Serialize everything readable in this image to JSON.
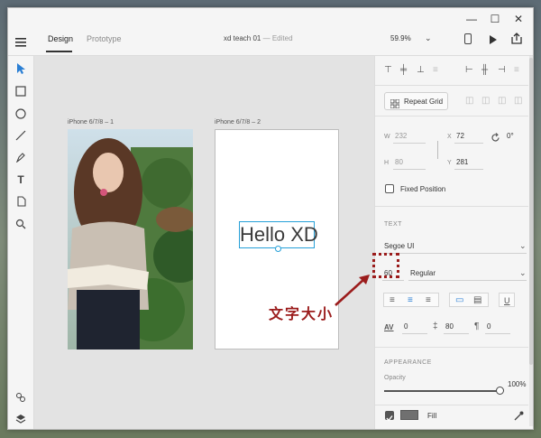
{
  "window": {
    "controls": [
      "—",
      "☐",
      "✕"
    ]
  },
  "toolbar": {
    "tabs": [
      {
        "label": "Design",
        "active": true
      },
      {
        "label": "Prototype",
        "active": false
      }
    ],
    "document_title": "xd teach 01",
    "document_separator": "—",
    "document_status": "Edited",
    "zoom": "59.9%"
  },
  "tools": [
    "select-tool",
    "rectangle-tool",
    "ellipse-tool",
    "line-tool",
    "pen-tool",
    "text-tool",
    "artboard-tool",
    "zoom-tool",
    "assets-tool",
    "layers-tool"
  ],
  "canvas": {
    "artboard1_label": "iPhone 6/7/8 – 1",
    "artboard2_label": "iPhone 6/7/8 – 2",
    "text_layer": "Hello XD"
  },
  "panel": {
    "repeat_grid_label": "Repeat Grid",
    "transform": {
      "w_label": "W",
      "w_value": "232",
      "h_label": "H",
      "h_value": "80",
      "x_label": "X",
      "x_value": "72",
      "y_label": "Y",
      "y_value": "281",
      "rotation": "0°"
    },
    "fixed_position_label": "Fixed Position",
    "text_section_label": "TEXT",
    "font_family": "Segoe UI",
    "font_size": "60",
    "font_weight": "Regular",
    "char_spacing": "0",
    "line_spacing": "80",
    "paragraph_spacing": "0",
    "appearance_label": "APPEARANCE",
    "opacity_label": "Opacity",
    "opacity_value": "100%",
    "opacity_level": 1.0,
    "fill_label": "Fill",
    "fill_color": "#707070"
  },
  "annotation": {
    "label": "文字大小",
    "color": "#9b1c1c"
  },
  "colors": {
    "selection": "#26a0d8",
    "panel_bg": "#f5f5f5",
    "canvas_bg": "#e3e3e3"
  }
}
